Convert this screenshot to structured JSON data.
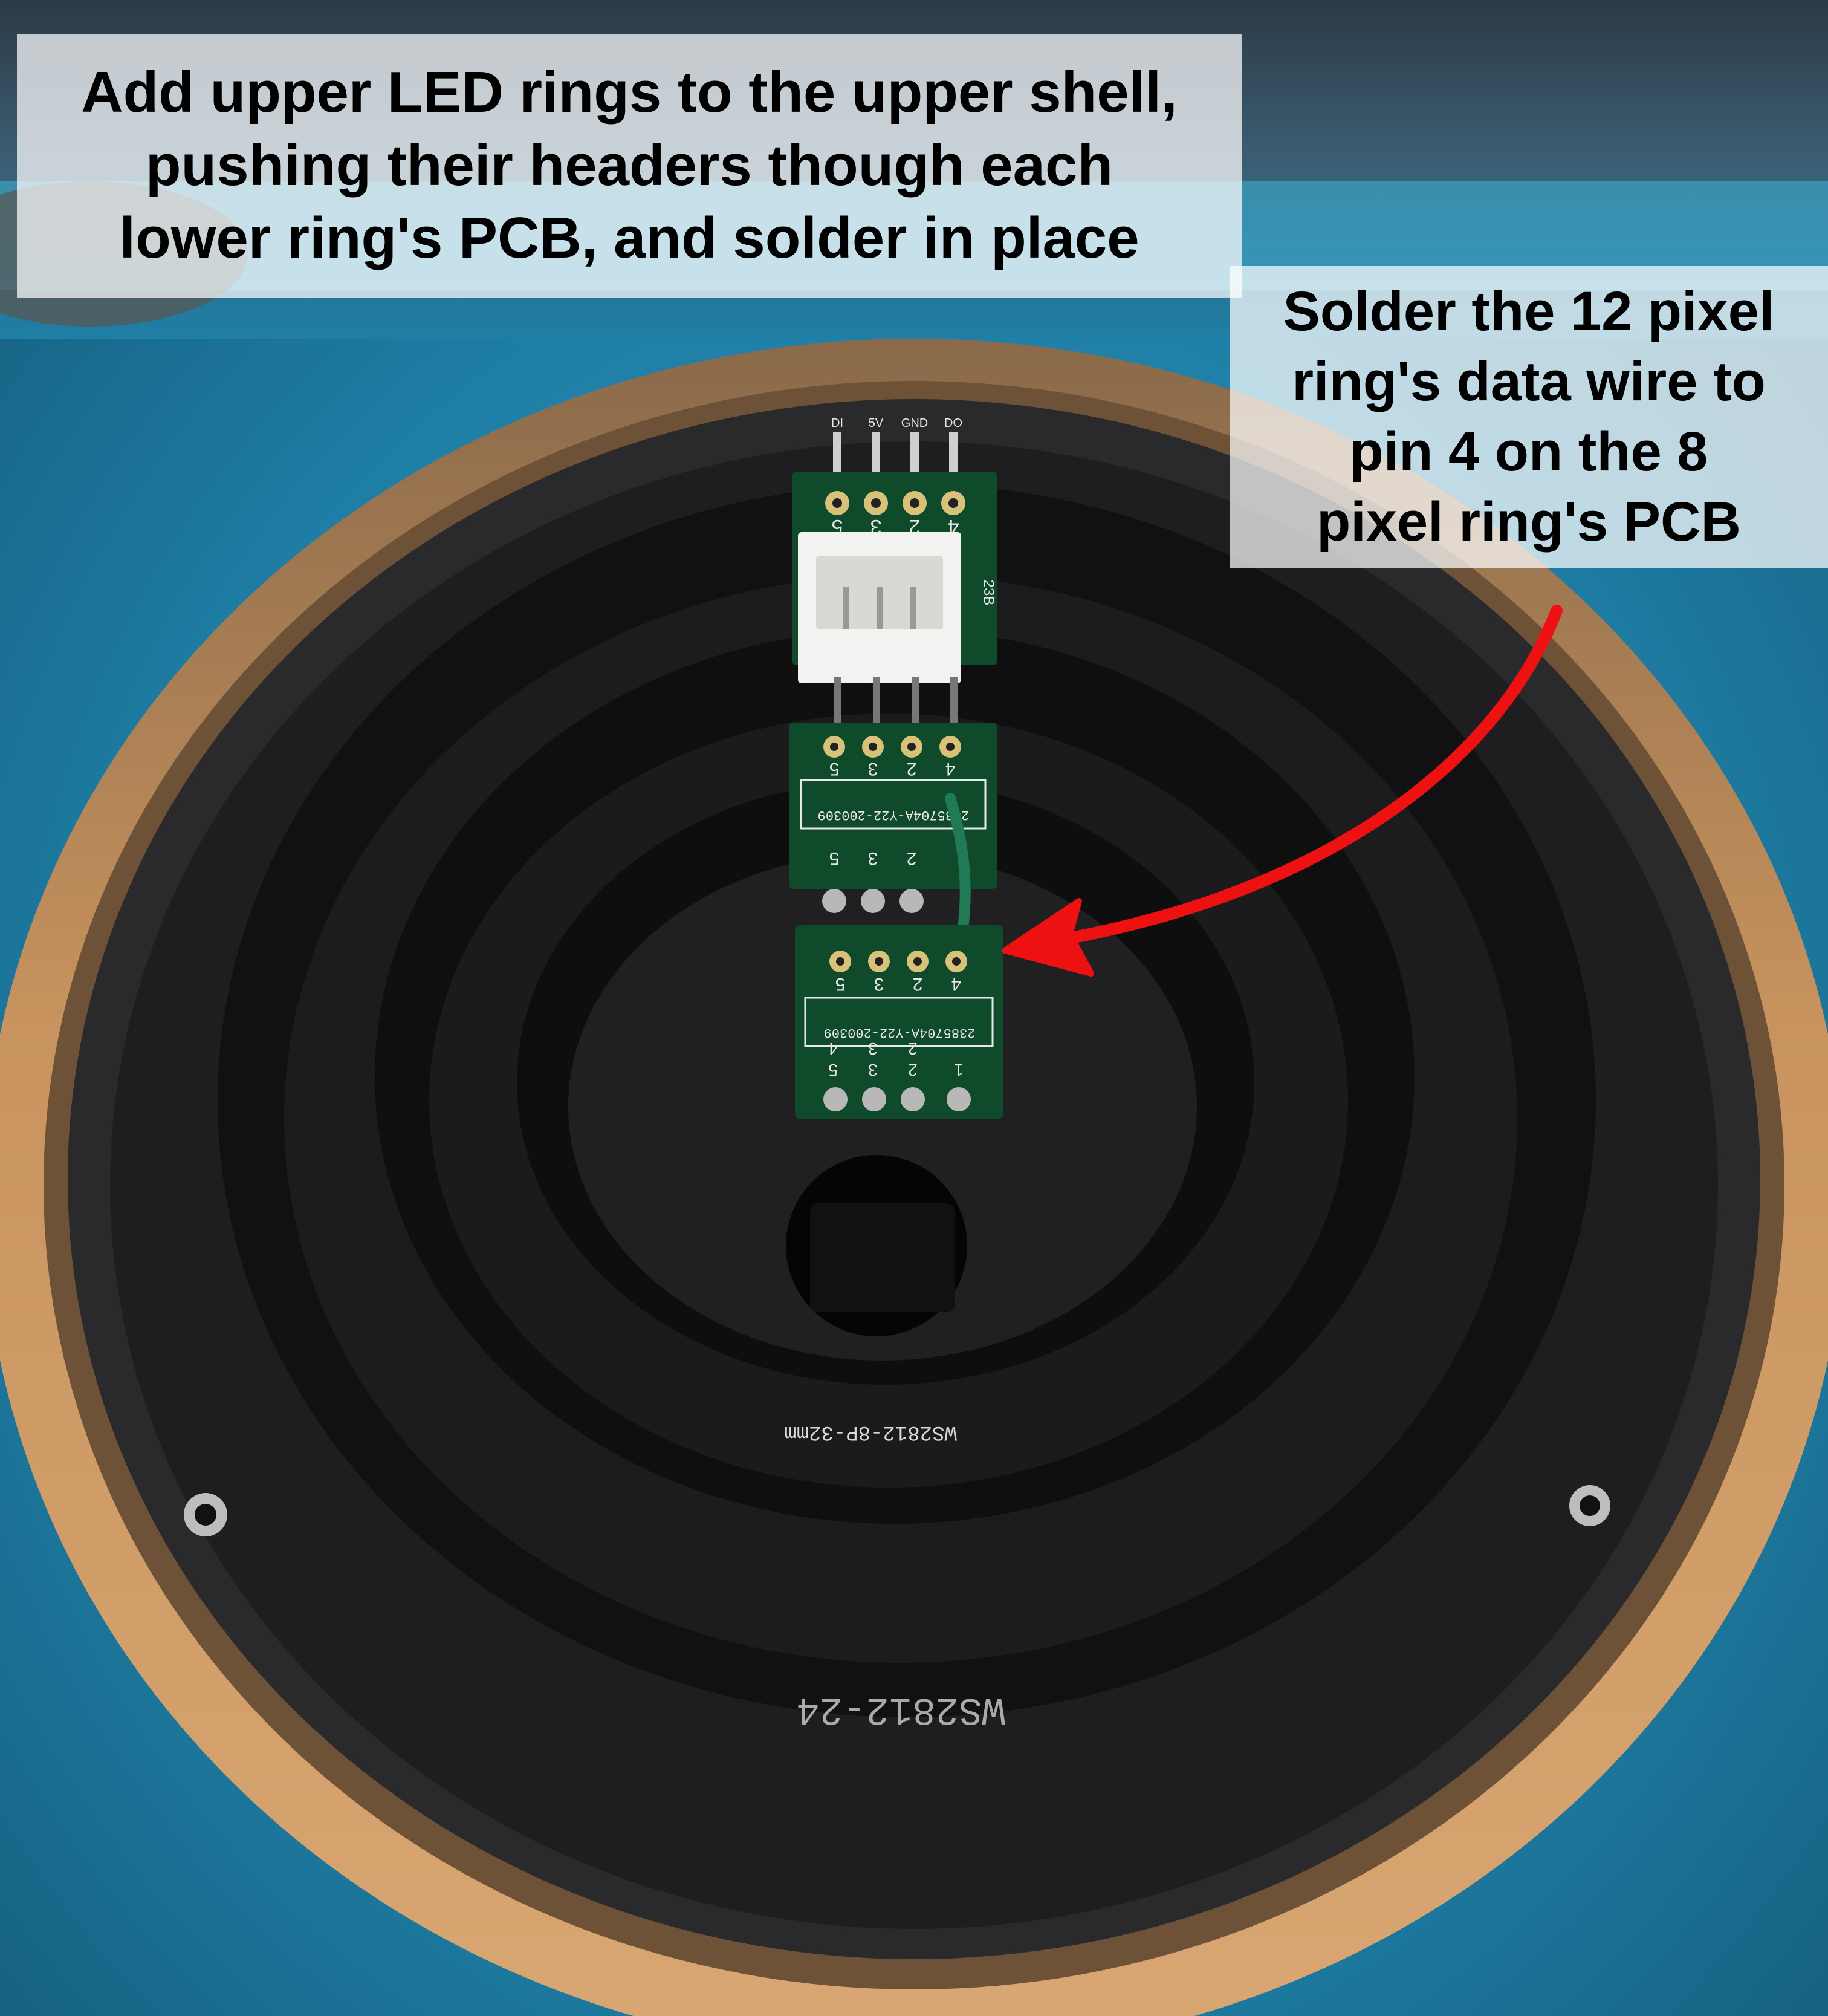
{
  "photo": {
    "subject": "",
    "colors": {
      "mat": "#1f7fa6",
      "mat_light": "#3fb0d6",
      "shell_outer": "#c8935e",
      "ring_black": "#1a1a1b",
      "pcb_green": "#0f4a2a",
      "connector_white": "#f2f2f0",
      "wire_green": "#1f7a55",
      "arrow_red": "#ee1111"
    },
    "pcb_silkscreen": {
      "header_labels": [
        "DI",
        "5V",
        "GND",
        "DO"
      ],
      "pin_numbers": [
        "5",
        "3",
        "2",
        "4"
      ],
      "bottom_pin_numbers": [
        "5",
        "3",
        "2",
        "1"
      ],
      "bottom_pin_sub_numbers": [
        "4",
        "3",
        "2",
        ""
      ],
      "part_code_partial": "23B",
      "part_code_mid": "2385704A-Y22-200309",
      "part_code_lower": "2385704A-Y22-200309",
      "ring_label_inner": "WS2812-8P-32mm",
      "ring_label_outer": "WS2812-24"
    }
  },
  "annotations": {
    "top": {
      "lines": [
        "Add upper LED rings to the upper shell,",
        "pushing their headers though each",
        "lower ring's PCB, and solder in place"
      ]
    },
    "side": {
      "lines": [
        "Solder the 12 pixel",
        "ring's data wire to",
        "pin 4 on the 8",
        "pixel ring's PCB"
      ]
    }
  }
}
